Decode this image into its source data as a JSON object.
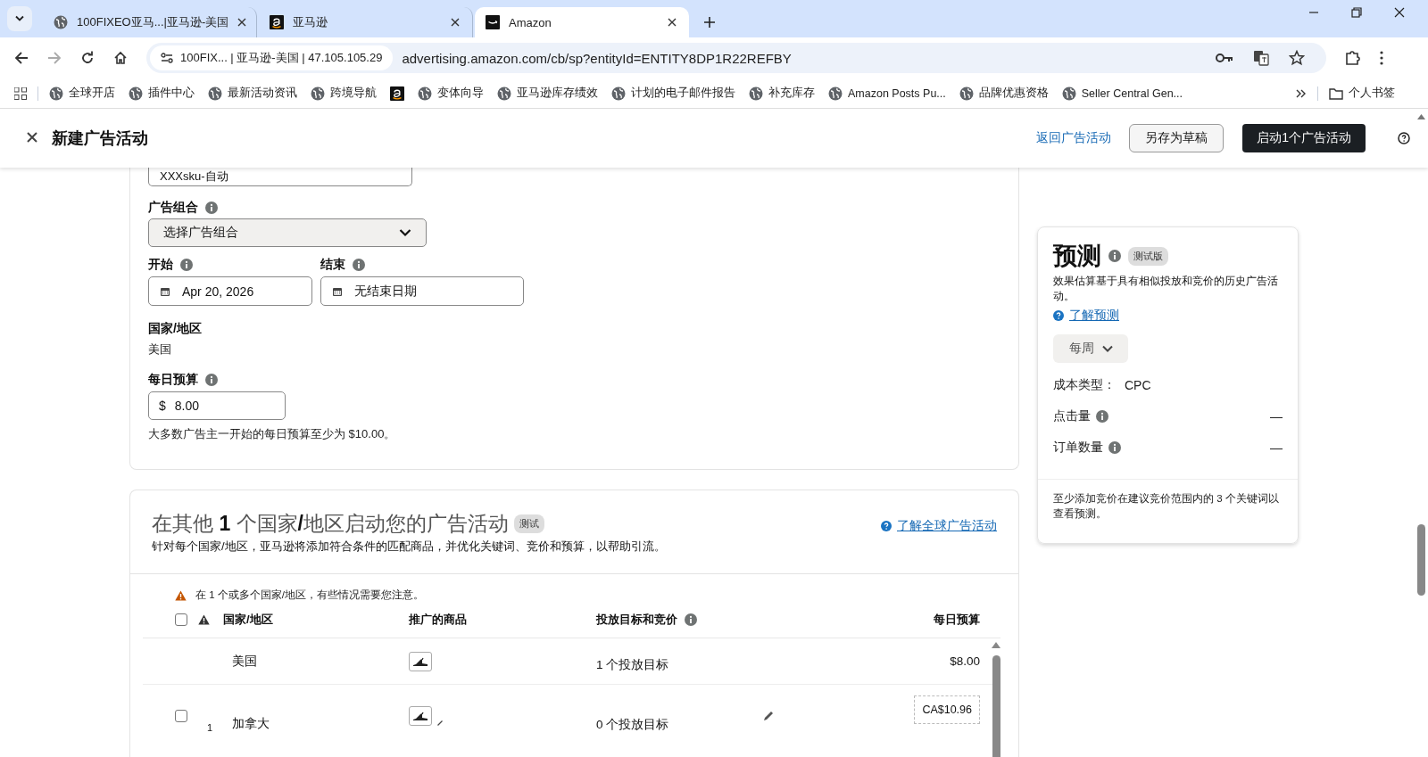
{
  "browser": {
    "tabs": [
      {
        "title": "100FIXEO亚马...|亚马逊-美国",
        "kind": "globe",
        "selected": false
      },
      {
        "title": "亚马逊",
        "kind": "amazon",
        "selected": false
      },
      {
        "title": "Amazon",
        "kind": "smile",
        "selected": true
      }
    ],
    "address": {
      "site_info": "100FIX... | 亚马逊-美国 | 47.105.105.29",
      "url": "advertising.amazon.com/cb/sp?entityId=ENTITY8DP1R22REFBY"
    },
    "bookmarks": [
      {
        "label": "全球开店",
        "kind": "globe"
      },
      {
        "label": "插件中心",
        "kind": "globe"
      },
      {
        "label": "最新活动资讯",
        "kind": "globe"
      },
      {
        "label": "跨境导航",
        "kind": "globe"
      },
      {
        "kind": "amazon"
      },
      {
        "label": "变体向导",
        "kind": "globe"
      },
      {
        "label": "亚马逊库存绩效",
        "kind": "globe"
      },
      {
        "label": "计划的电子邮件报告",
        "kind": "globe"
      },
      {
        "label": "补充库存",
        "kind": "globe"
      },
      {
        "label": "Amazon Posts Pu...",
        "kind": "globe"
      },
      {
        "label": "品牌优惠资格",
        "kind": "globe"
      },
      {
        "label": "Seller Central Gen...",
        "kind": "globe"
      }
    ],
    "bookmark_folder": "个人书签"
  },
  "header": {
    "title": "新建广告活动",
    "back_link": "返回广告活动",
    "save_button": "另存为草稿",
    "launch_button": "启动1个广告活动"
  },
  "form": {
    "name_value": "XXXsku-自动",
    "portfolio": {
      "label": "广告组合",
      "placeholder": "选择广告组合"
    },
    "start": {
      "label": "开始",
      "value": "Apr 20, 2026"
    },
    "end": {
      "label": "结束",
      "value": "无结束日期"
    },
    "country": {
      "label": "国家/地区",
      "value": "美国"
    },
    "budget": {
      "label": "每日预算",
      "prefix": "$",
      "value": "8.00",
      "hint": "大多数广告主一开始的每日预算至少为 $10.00。"
    }
  },
  "forecast": {
    "title": "预测",
    "badge": "测试版",
    "description": "效果估算基于具有相似投放和竞价的历史广告活动。",
    "link": "了解预测",
    "period": "每周",
    "cost_type_label": "成本类型：",
    "cost_type": "CPC",
    "metrics": [
      {
        "label": "点击量",
        "value": "—"
      },
      {
        "label": "订单数量",
        "value": "—"
      }
    ],
    "note": "至少添加竞价在建议竞价范围内的 3 个关键词以查看预测。"
  },
  "global": {
    "title": "在其他 **1** 个国家**/**地区启动您的广告活动",
    "badge": "测试",
    "description": "针对每个国家/地区，亚马逊将添加符合条件的匹配商品，并优化关键词、竞价和预算，以帮助引流。",
    "link": "了解全球广告活动",
    "warning": "在 1 个或多个国家/地区，有些情况需要您注意。",
    "select_all_checked": false,
    "columns": [
      "国家/地区",
      "推广的商品",
      "投放目标和竞价",
      "每日预算"
    ],
    "rows": [
      {
        "kind": "static",
        "country": "美国",
        "targets": "1 个投放目标",
        "budget": "$8.00"
      },
      {
        "kind": "editable",
        "checked": false,
        "index": "1",
        "country": "加拿大",
        "targets": "0 个投放目标",
        "budget": "CA$10.96"
      }
    ]
  }
}
